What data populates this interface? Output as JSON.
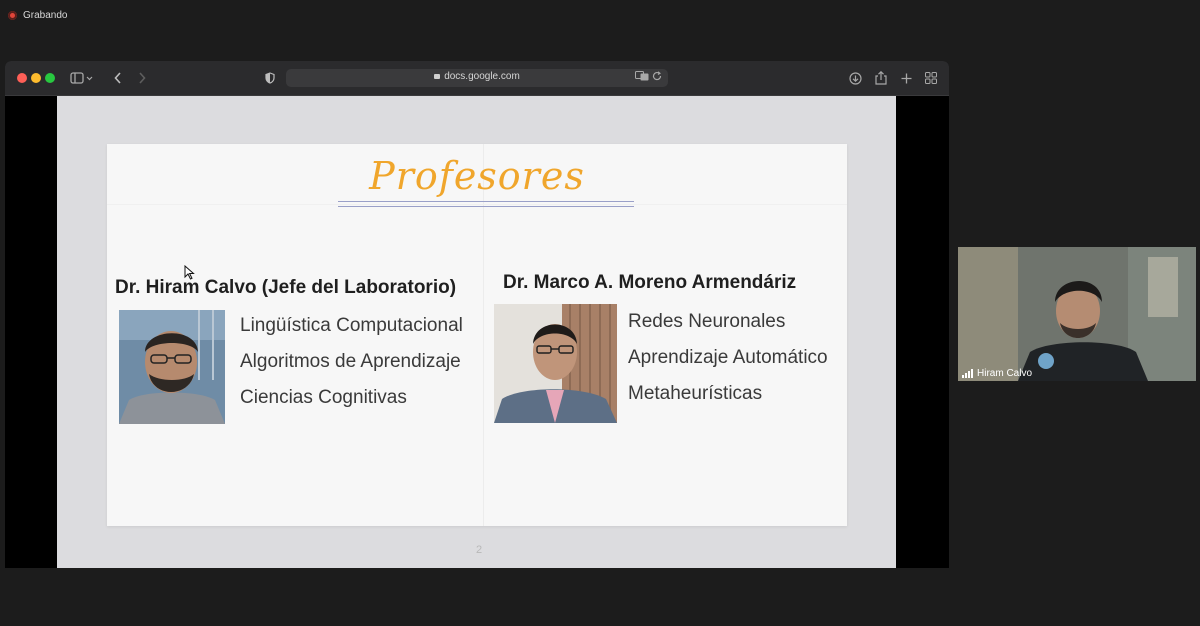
{
  "recording": {
    "label": "Grabando"
  },
  "browser": {
    "url": "docs.google.com"
  },
  "slide": {
    "title": "Profesores",
    "page_number": "2",
    "professors": [
      {
        "name": "Dr. Hiram Calvo (Jefe del Laboratorio)",
        "areas": [
          "Lingüística Computacional",
          "Algoritmos de Aprendizaje",
          "Ciencias Cognitivas"
        ]
      },
      {
        "name": "Dr. Marco A. Moreno Armendáriz",
        "areas": [
          "Redes Neuronales",
          "Aprendizaje Automático",
          "Metaheurísticas"
        ]
      }
    ]
  },
  "video": {
    "participant_name": "Hiram Calvo"
  },
  "colors": {
    "title": "#f0a62c",
    "record": "#e0453a",
    "background": "#1c1c1c"
  },
  "icons": [
    "record-icon",
    "sidebar-icon",
    "back-icon",
    "forward-icon",
    "shield-icon",
    "lock-icon",
    "translate-icon",
    "reload-icon",
    "download-icon",
    "share-icon",
    "new-tab-icon",
    "tab-overview-icon",
    "signal-icon",
    "cursor-icon"
  ]
}
